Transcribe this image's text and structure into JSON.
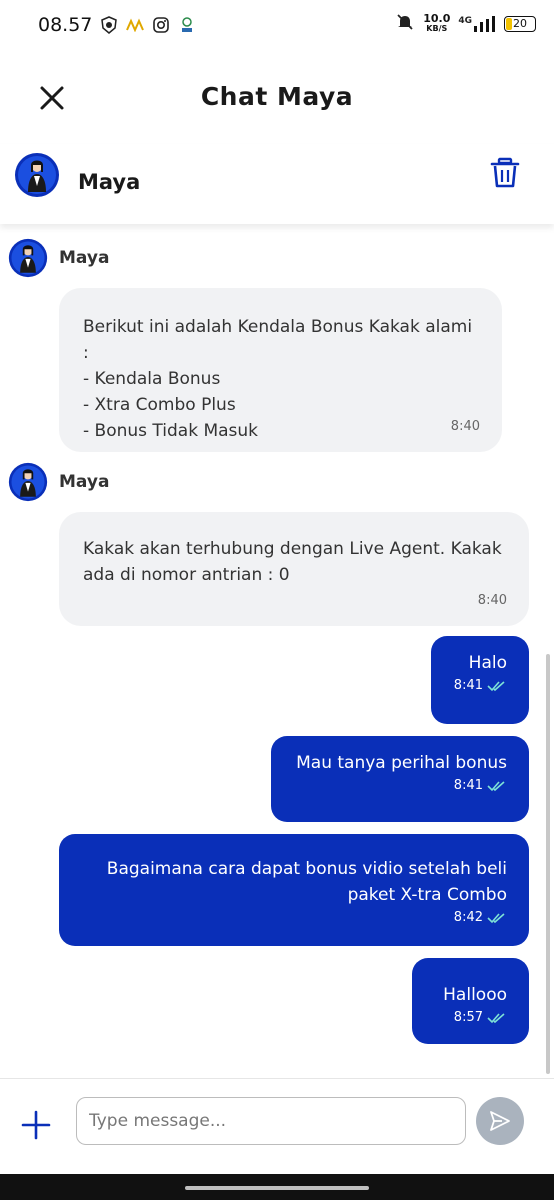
{
  "status_bar": {
    "time": "08.57",
    "net_speed_value": "10.0",
    "net_speed_unit": "KB/S",
    "network": "4G",
    "battery": "20"
  },
  "header": {
    "title": "Chat Maya",
    "close_icon": "close-icon"
  },
  "agent": {
    "name": "Maya",
    "delete_icon": "trash-icon"
  },
  "messages": [
    {
      "direction": "incoming",
      "sender": "Maya",
      "text": "Berikut ini adalah Kendala Bonus Kakak alami :\n- Kendala Bonus\n- Xtra Combo Plus\n- Bonus Tidak Masuk",
      "time": "8:40"
    },
    {
      "direction": "incoming",
      "sender": "Maya",
      "text": "Kakak akan terhubung dengan Live Agent. Kakak\nada di nomor antrian : 0",
      "time": "8:40"
    },
    {
      "direction": "outgoing",
      "text": "Halo",
      "time": "8:41",
      "status": "read"
    },
    {
      "direction": "outgoing",
      "text": "Mau tanya perihal bonus",
      "time": "8:41",
      "status": "read"
    },
    {
      "direction": "outgoing",
      "text": "Bagaimana cara dapat bonus vidio setelah beli\npaket X-tra Combo",
      "time": "8:42",
      "status": "read"
    },
    {
      "direction": "outgoing",
      "text": "Hallooo",
      "time": "8:57",
      "status": "read"
    }
  ],
  "composer": {
    "placeholder": "Type message...",
    "value": ""
  },
  "colors": {
    "outgoing_bubble": "#0a2fb8",
    "incoming_bubble": "#f1f2f4",
    "read_ticks": "#7ee3d6",
    "accent": "#0a2fb8",
    "send_button_disabled": "#aab3be"
  }
}
